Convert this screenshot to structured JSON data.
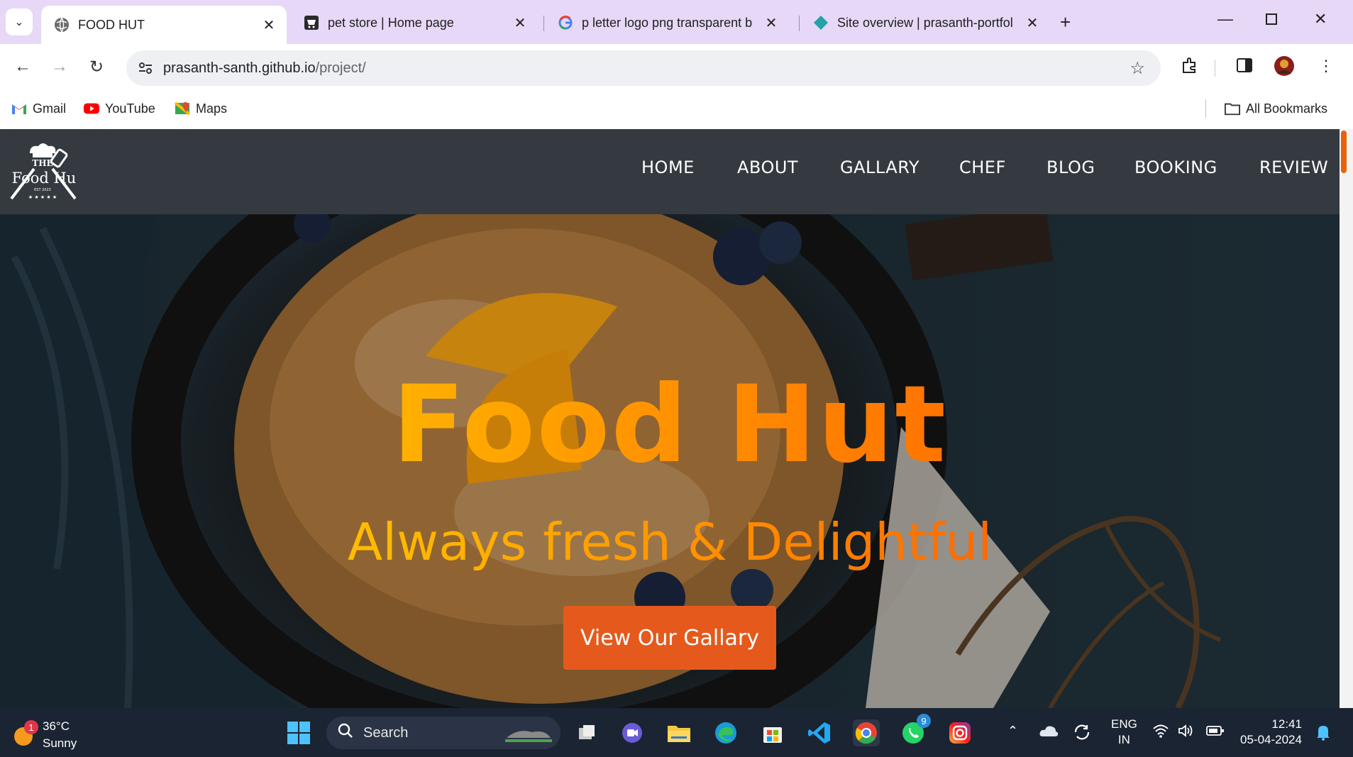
{
  "browser": {
    "tabs": [
      {
        "title": "FOOD HUT",
        "active": true,
        "icon": "globe-icon"
      },
      {
        "title": "pet store | Home page",
        "active": false,
        "icon": "store-icon"
      },
      {
        "title": "p letter logo png transparent b",
        "active": false,
        "icon": "google-icon"
      },
      {
        "title": "Site overview | prasanth-portfol",
        "active": false,
        "icon": "netlify-icon"
      }
    ],
    "url_host": "prasanth-santh.github.io",
    "url_path": "/project/",
    "bookmarks": [
      {
        "label": "Gmail",
        "icon": "gmail-icon"
      },
      {
        "label": "YouTube",
        "icon": "youtube-icon"
      },
      {
        "label": "Maps",
        "icon": "maps-icon"
      }
    ],
    "all_bookmarks": "All Bookmarks"
  },
  "site": {
    "logo": {
      "line1": "THE",
      "line2": "Food Hu",
      "line3": "EST 2023"
    },
    "nav": [
      "HOME",
      "ABOUT",
      "GALLARY",
      "CHEF",
      "BLOG",
      "BOOKING",
      "REVIEW"
    ],
    "hero": {
      "title": "Food Hut",
      "subtitle": "Always fresh & Delightful",
      "button": "View Our Gallary"
    }
  },
  "taskbar": {
    "weather_temp": "36°C",
    "weather_desc": "Sunny",
    "weather_badge": "1",
    "search_placeholder": "Search",
    "whatsapp_badge": "9",
    "lang_top": "ENG",
    "lang_bottom": "IN",
    "time": "12:41",
    "date": "05-04-2024"
  },
  "colors": {
    "nav_bg": "#343a40",
    "button_bg": "#e55a1c",
    "tab_strip": "#e6d8f6"
  }
}
